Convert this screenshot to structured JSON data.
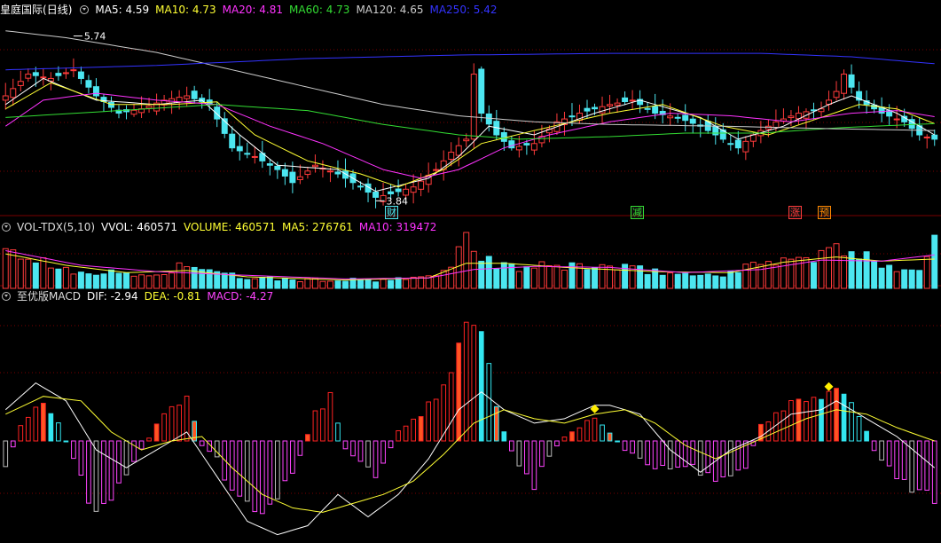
{
  "colors": {
    "up": "#ff3b3b",
    "down": "#4ce6f0",
    "ma5": "#ffffff",
    "ma10": "#ffff33",
    "ma20": "#ff33ff",
    "ma60": "#33dd33",
    "ma120": "#cccccc",
    "ma250": "#3333ff",
    "grid": "#7a0000",
    "dif": "#ffffff",
    "dea": "#ffff33",
    "macd_pos": "#ff2222",
    "macd_neg": "#ff44ff",
    "macd_neg2": "#bbbbbb",
    "macd_hi": "#ff5522",
    "macd_cyan": "#33e6f0",
    "marker": "#ffee00"
  },
  "price_panel": {
    "stock": "皇庭国际",
    "period": "(日线)",
    "indicators": [
      {
        "label": "MA5:",
        "value": "4.59",
        "color": "#ffffff"
      },
      {
        "label": "MA10:",
        "value": "4.73",
        "color": "#ffff33"
      },
      {
        "label": "MA20:",
        "value": "4.81",
        "color": "#ff33ff"
      },
      {
        "label": "MA60:",
        "value": "4.73",
        "color": "#33dd33"
      },
      {
        "label": "MA120:",
        "value": "4.65",
        "color": "#cccccc"
      },
      {
        "label": "MA250:",
        "value": "5.42",
        "color": "#3333ff"
      }
    ],
    "high_label": "5.74",
    "low_label": "3.84",
    "event_tags": [
      {
        "text": "财",
        "color": "#4ce6f0"
      },
      {
        "text": "减",
        "color": "#33dd33"
      },
      {
        "text": "涨",
        "color": "#ff3b3b"
      },
      {
        "text": "预",
        "color": "#ff8800"
      }
    ]
  },
  "volume_panel": {
    "title": "VOL-TDX(5,10)",
    "indicators": [
      {
        "label": "VVOL:",
        "value": "460571",
        "color": "#ffffff"
      },
      {
        "label": "VOLUME:",
        "value": "460571",
        "color": "#ffff33"
      },
      {
        "label": "MA5:",
        "value": "276761",
        "color": "#ffff33"
      },
      {
        "label": "MA10:",
        "value": "319472",
        "color": "#ff33ff"
      }
    ]
  },
  "macd_panel": {
    "title": "至优版MACD",
    "indicators": [
      {
        "label": "DIF:",
        "value": "-2.94",
        "color": "#ffffff"
      },
      {
        "label": "DEA:",
        "value": "-0.81",
        "color": "#ffff33"
      },
      {
        "label": "MACD:",
        "value": "-4.27",
        "color": "#ff44ff"
      }
    ]
  },
  "chart_data": {
    "type": "candlestick",
    "title": "皇庭国际 (日线)",
    "n_bars": 124,
    "price_range": [
      3.7,
      5.95
    ],
    "close_anchors": [
      [
        0,
        5.05
      ],
      [
        3,
        5.3
      ],
      [
        6,
        5.25
      ],
      [
        9,
        5.35
      ],
      [
        12,
        5.05
      ],
      [
        15,
        4.85
      ],
      [
        18,
        4.9
      ],
      [
        21,
        5.0
      ],
      [
        24,
        5.05
      ],
      [
        27,
        4.95
      ],
      [
        30,
        4.45
      ],
      [
        33,
        4.35
      ],
      [
        36,
        4.2
      ],
      [
        38,
        4.05
      ],
      [
        41,
        4.25
      ],
      [
        44,
        4.15
      ],
      [
        47,
        4.0
      ],
      [
        49,
        3.88
      ],
      [
        51,
        3.92
      ],
      [
        54,
        4.0
      ],
      [
        57,
        4.2
      ],
      [
        59,
        4.4
      ],
      [
        61,
        4.55
      ],
      [
        62,
        5.3
      ],
      [
        63,
        4.85
      ],
      [
        65,
        4.6
      ],
      [
        67,
        4.45
      ],
      [
        70,
        4.5
      ],
      [
        73,
        4.75
      ],
      [
        76,
        4.85
      ],
      [
        80,
        4.95
      ],
      [
        83,
        5.0
      ],
      [
        86,
        4.85
      ],
      [
        89,
        4.8
      ],
      [
        92,
        4.7
      ],
      [
        95,
        4.55
      ],
      [
        97,
        4.45
      ],
      [
        99,
        4.6
      ],
      [
        102,
        4.75
      ],
      [
        105,
        4.85
      ],
      [
        108,
        4.9
      ],
      [
        110,
        5.1
      ],
      [
        111,
        5.3
      ],
      [
        113,
        5.0
      ],
      [
        116,
        4.85
      ],
      [
        119,
        4.75
      ],
      [
        121,
        4.6
      ],
      [
        123,
        4.55
      ]
    ],
    "ma_anchors": {
      "MA5": [
        [
          0,
          4.95
        ],
        [
          5,
          5.25
        ],
        [
          12,
          5.0
        ],
        [
          20,
          4.95
        ],
        [
          26,
          5.0
        ],
        [
          31,
          4.6
        ],
        [
          36,
          4.25
        ],
        [
          44,
          4.2
        ],
        [
          49,
          3.95
        ],
        [
          56,
          4.1
        ],
        [
          60,
          4.35
        ],
        [
          64,
          4.7
        ],
        [
          70,
          4.6
        ],
        [
          78,
          4.85
        ],
        [
          84,
          5.0
        ],
        [
          92,
          4.8
        ],
        [
          97,
          4.55
        ],
        [
          103,
          4.7
        ],
        [
          109,
          4.95
        ],
        [
          112,
          5.05
        ],
        [
          118,
          4.85
        ],
        [
          123,
          4.6
        ]
      ],
      "MA10": [
        [
          0,
          4.9
        ],
        [
          6,
          5.2
        ],
        [
          14,
          4.95
        ],
        [
          22,
          4.95
        ],
        [
          28,
          4.98
        ],
        [
          33,
          4.6
        ],
        [
          40,
          4.3
        ],
        [
          47,
          4.15
        ],
        [
          52,
          4.0
        ],
        [
          58,
          4.2
        ],
        [
          63,
          4.5
        ],
        [
          70,
          4.65
        ],
        [
          80,
          4.85
        ],
        [
          87,
          4.95
        ],
        [
          95,
          4.7
        ],
        [
          101,
          4.6
        ],
        [
          108,
          4.8
        ],
        [
          113,
          4.95
        ],
        [
          118,
          4.9
        ],
        [
          123,
          4.73
        ]
      ],
      "MA20": [
        [
          0,
          4.7
        ],
        [
          5,
          5.0
        ],
        [
          12,
          5.08
        ],
        [
          20,
          5.0
        ],
        [
          28,
          4.95
        ],
        [
          35,
          4.7
        ],
        [
          42,
          4.5
        ],
        [
          50,
          4.2
        ],
        [
          55,
          4.1
        ],
        [
          60,
          4.2
        ],
        [
          66,
          4.45
        ],
        [
          72,
          4.6
        ],
        [
          80,
          4.75
        ],
        [
          88,
          4.85
        ],
        [
          96,
          4.82
        ],
        [
          104,
          4.75
        ],
        [
          112,
          4.85
        ],
        [
          118,
          4.88
        ],
        [
          123,
          4.81
        ]
      ],
      "MA60": [
        [
          0,
          4.8
        ],
        [
          15,
          4.88
        ],
        [
          28,
          4.95
        ],
        [
          40,
          4.88
        ],
        [
          50,
          4.72
        ],
        [
          60,
          4.6
        ],
        [
          68,
          4.55
        ],
        [
          80,
          4.58
        ],
        [
          90,
          4.62
        ],
        [
          100,
          4.62
        ],
        [
          110,
          4.68
        ],
        [
          123,
          4.73
        ]
      ],
      "MA120": [
        [
          0,
          5.8
        ],
        [
          8,
          5.72
        ],
        [
          20,
          5.55
        ],
        [
          30,
          5.35
        ],
        [
          40,
          5.15
        ],
        [
          50,
          4.95
        ],
        [
          60,
          4.82
        ],
        [
          70,
          4.75
        ],
        [
          80,
          4.72
        ],
        [
          95,
          4.7
        ],
        [
          110,
          4.67
        ],
        [
          123,
          4.65
        ]
      ],
      "MA250": [
        [
          0,
          5.35
        ],
        [
          20,
          5.4
        ],
        [
          40,
          5.48
        ],
        [
          60,
          5.52
        ],
        [
          80,
          5.54
        ],
        [
          100,
          5.54
        ],
        [
          112,
          5.5
        ],
        [
          123,
          5.42
        ]
      ]
    },
    "volume_anchors": [
      [
        0,
        0.42
      ],
      [
        2,
        0.3
      ],
      [
        4,
        0.28
      ],
      [
        6,
        0.22
      ],
      [
        9,
        0.18
      ],
      [
        12,
        0.15
      ],
      [
        15,
        0.14
      ],
      [
        20,
        0.12
      ],
      [
        24,
        0.24
      ],
      [
        27,
        0.15
      ],
      [
        32,
        0.1
      ],
      [
        38,
        0.08
      ],
      [
        45,
        0.08
      ],
      [
        50,
        0.07
      ],
      [
        55,
        0.1
      ],
      [
        58,
        0.15
      ],
      [
        61,
        0.5
      ],
      [
        63,
        0.3
      ],
      [
        66,
        0.2
      ],
      [
        70,
        0.2
      ],
      [
        75,
        0.22
      ],
      [
        80,
        0.2
      ],
      [
        86,
        0.16
      ],
      [
        92,
        0.12
      ],
      [
        97,
        0.16
      ],
      [
        100,
        0.25
      ],
      [
        103,
        0.3
      ],
      [
        106,
        0.26
      ],
      [
        110,
        0.38
      ],
      [
        112,
        0.32
      ],
      [
        117,
        0.22
      ],
      [
        121,
        0.18
      ],
      [
        123,
        0.46
      ]
    ],
    "vol_ma5_anchors": [
      [
        0,
        0.33
      ],
      [
        8,
        0.22
      ],
      [
        16,
        0.15
      ],
      [
        24,
        0.17
      ],
      [
        32,
        0.11
      ],
      [
        45,
        0.08
      ],
      [
        56,
        0.1
      ],
      [
        61,
        0.24
      ],
      [
        66,
        0.24
      ],
      [
        74,
        0.2
      ],
      [
        86,
        0.16
      ],
      [
        96,
        0.15
      ],
      [
        103,
        0.25
      ],
      [
        110,
        0.3
      ],
      [
        116,
        0.26
      ],
      [
        123,
        0.28
      ]
    ],
    "vol_ma10_anchors": [
      [
        0,
        0.36
      ],
      [
        10,
        0.22
      ],
      [
        20,
        0.16
      ],
      [
        30,
        0.13
      ],
      [
        45,
        0.09
      ],
      [
        56,
        0.1
      ],
      [
        62,
        0.18
      ],
      [
        70,
        0.21
      ],
      [
        80,
        0.2
      ],
      [
        90,
        0.15
      ],
      [
        100,
        0.18
      ],
      [
        108,
        0.27
      ],
      [
        116,
        0.26
      ],
      [
        123,
        0.32
      ]
    ],
    "macd_hist_anchors": [
      [
        0,
        -0.3
      ],
      [
        2,
        0.15
      ],
      [
        5,
        0.45
      ],
      [
        7,
        0.2
      ],
      [
        9,
        -0.2
      ],
      [
        12,
        -0.85
      ],
      [
        15,
        -0.55
      ],
      [
        18,
        -0.1
      ],
      [
        21,
        0.3
      ],
      [
        24,
        0.5
      ],
      [
        26,
        -0.05
      ],
      [
        28,
        -0.2
      ],
      [
        30,
        -0.6
      ],
      [
        34,
        -0.75
      ],
      [
        38,
        -0.4
      ],
      [
        41,
        0.3
      ],
      [
        43,
        0.5
      ],
      [
        45,
        -0.1
      ],
      [
        47,
        -0.2
      ],
      [
        49,
        -0.45
      ],
      [
        52,
        0.1
      ],
      [
        55,
        0.3
      ],
      [
        58,
        0.55
      ],
      [
        61,
        1.25
      ],
      [
        63,
        1.3
      ],
      [
        64,
        0.8
      ],
      [
        66,
        0.1
      ],
      [
        68,
        -0.3
      ],
      [
        70,
        -0.5
      ],
      [
        72,
        -0.15
      ],
      [
        74,
        0.05
      ],
      [
        76,
        0.15
      ],
      [
        78,
        0.25
      ],
      [
        80,
        0.1
      ],
      [
        82,
        -0.1
      ],
      [
        86,
        -0.3
      ],
      [
        90,
        -0.25
      ],
      [
        94,
        -0.45
      ],
      [
        98,
        -0.3
      ],
      [
        100,
        0.2
      ],
      [
        104,
        0.4
      ],
      [
        107,
        0.5
      ],
      [
        110,
        0.6
      ],
      [
        113,
        0.3
      ],
      [
        115,
        -0.1
      ],
      [
        118,
        -0.4
      ],
      [
        121,
        -0.55
      ],
      [
        123,
        -0.7
      ]
    ],
    "dif_anchors": [
      [
        0,
        0.35
      ],
      [
        4,
        0.65
      ],
      [
        8,
        0.45
      ],
      [
        12,
        -0.1
      ],
      [
        16,
        -0.3
      ],
      [
        20,
        -0.1
      ],
      [
        24,
        0.1
      ],
      [
        28,
        -0.4
      ],
      [
        32,
        -0.9
      ],
      [
        36,
        -1.05
      ],
      [
        40,
        -0.95
      ],
      [
        44,
        -0.6
      ],
      [
        48,
        -0.85
      ],
      [
        52,
        -0.6
      ],
      [
        56,
        -0.2
      ],
      [
        60,
        0.35
      ],
      [
        63,
        0.55
      ],
      [
        66,
        0.35
      ],
      [
        70,
        0.2
      ],
      [
        74,
        0.25
      ],
      [
        78,
        0.4
      ],
      [
        80,
        0.4
      ],
      [
        84,
        0.3
      ],
      [
        88,
        -0.1
      ],
      [
        92,
        -0.35
      ],
      [
        96,
        -0.1
      ],
      [
        100,
        0.05
      ],
      [
        104,
        0.3
      ],
      [
        108,
        0.35
      ],
      [
        110,
        0.45
      ],
      [
        114,
        0.25
      ],
      [
        118,
        0.05
      ],
      [
        123,
        -0.3
      ]
    ],
    "dea_anchors": [
      [
        0,
        0.3
      ],
      [
        5,
        0.5
      ],
      [
        10,
        0.45
      ],
      [
        14,
        0.1
      ],
      [
        18,
        -0.1
      ],
      [
        22,
        0.0
      ],
      [
        26,
        0.05
      ],
      [
        30,
        -0.3
      ],
      [
        34,
        -0.6
      ],
      [
        38,
        -0.75
      ],
      [
        42,
        -0.8
      ],
      [
        46,
        -0.7
      ],
      [
        50,
        -0.6
      ],
      [
        54,
        -0.45
      ],
      [
        58,
        -0.15
      ],
      [
        62,
        0.2
      ],
      [
        66,
        0.35
      ],
      [
        70,
        0.25
      ],
      [
        74,
        0.2
      ],
      [
        78,
        0.3
      ],
      [
        82,
        0.35
      ],
      [
        86,
        0.2
      ],
      [
        90,
        -0.05
      ],
      [
        94,
        -0.2
      ],
      [
        98,
        -0.05
      ],
      [
        102,
        0.1
      ],
      [
        106,
        0.25
      ],
      [
        110,
        0.35
      ],
      [
        114,
        0.3
      ],
      [
        118,
        0.15
      ],
      [
        123,
        0.0
      ]
    ],
    "macd_range": [
      -1.2,
      1.4
    ]
  }
}
